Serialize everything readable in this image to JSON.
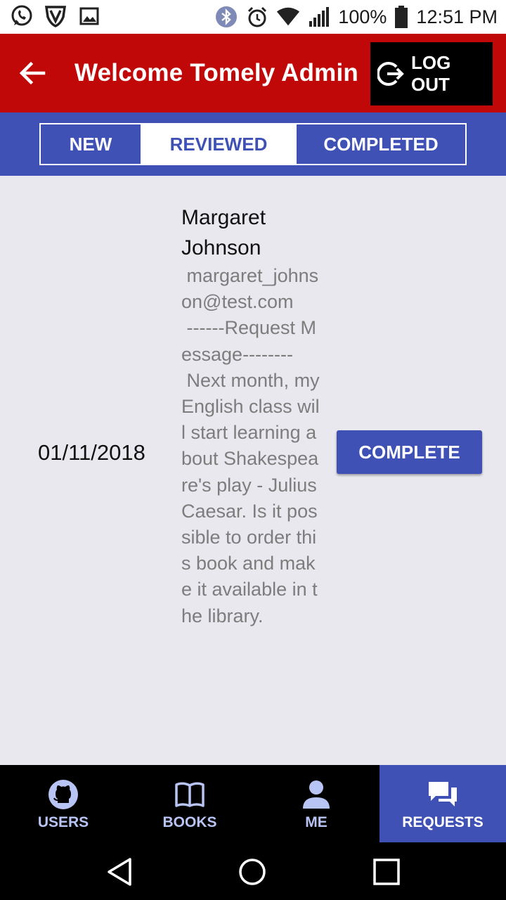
{
  "status_bar": {
    "battery": "100%",
    "time": "12:51 PM"
  },
  "header": {
    "title": "Welcome Tomely Admin",
    "logout_label": "LOG OUT"
  },
  "tabs": [
    {
      "label": "NEW"
    },
    {
      "label": "REVIEWED",
      "selected": true
    },
    {
      "label": "COMPLETED"
    }
  ],
  "request": {
    "date": "01/11/2018",
    "name": "Margaret Johnson",
    "detail": " margaret_johnson@test.com\n ------Request Message--------\n Next month, my English class will start learning about Shakespeare's play - Julius Caesar. Is it possible to order this book and make it available in the library.",
    "button_label": "COMPLETE"
  },
  "bottom_nav": [
    {
      "label": "USERS",
      "icon": "github-icon"
    },
    {
      "label": "BOOKS",
      "icon": "book-icon"
    },
    {
      "label": "ME",
      "icon": "person-icon"
    },
    {
      "label": "REQUESTS",
      "icon": "chat-icon",
      "active": true
    }
  ],
  "colors": {
    "appbar": "#c10808",
    "primary": "#3f51b5",
    "background": "#e8e8ee"
  }
}
